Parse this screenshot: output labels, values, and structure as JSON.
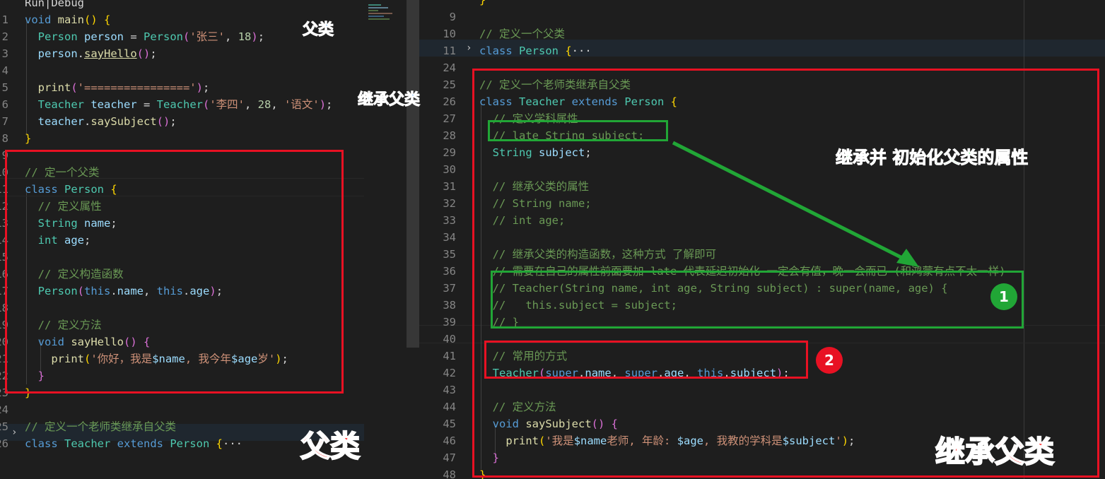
{
  "annotations": {
    "left_parent_small": "父类",
    "inherit_parent_small": "继承父类",
    "init_props": "继承并 初始化父类的属性",
    "left_parent_big": "父类",
    "right_inherit_big": "继承父类",
    "badge1": "1",
    "badge2": "2"
  },
  "colors": {
    "background": "#1e1e1e",
    "red_box": "#e81123",
    "green_box": "#21a636",
    "blue_annotation": "#1e90ff",
    "green_annotation": "#21c23a",
    "red_annotation": "#ff1a1a"
  },
  "left": {
    "lines": [
      {
        "ln": "",
        "tokens": [
          [
            "pl",
            "Run|Debug"
          ]
        ]
      },
      {
        "ln": "1",
        "tokens": [
          [
            "kw",
            "void "
          ],
          [
            "fn",
            "main"
          ],
          [
            "br",
            "() {"
          ]
        ]
      },
      {
        "ln": "2",
        "tokens": [
          [
            "ty",
            "  Person "
          ],
          [
            "va",
            "person"
          ],
          [
            "pl",
            " = "
          ],
          [
            "ty",
            "Person"
          ],
          [
            "br2",
            "("
          ],
          [
            "st",
            "'张三'"
          ],
          [
            "pl",
            ", "
          ],
          [
            "nu",
            "18"
          ],
          [
            "br2",
            ")"
          ],
          [
            "pl",
            ";"
          ]
        ]
      },
      {
        "ln": "3",
        "tokens": [
          [
            "va",
            "  person"
          ],
          [
            "pl",
            "."
          ],
          [
            "fnu",
            "sayHello"
          ],
          [
            "br2",
            "()"
          ],
          [
            "pl",
            ";"
          ]
        ]
      },
      {
        "ln": "4",
        "tokens": [
          [
            "pl",
            ""
          ]
        ]
      },
      {
        "ln": "5",
        "tokens": [
          [
            "fn",
            "  print"
          ],
          [
            "br2",
            "("
          ],
          [
            "st",
            "'================'"
          ],
          [
            "br2",
            ")"
          ],
          [
            "pl",
            ";"
          ]
        ]
      },
      {
        "ln": "6",
        "tokens": [
          [
            "ty",
            "  Teacher "
          ],
          [
            "va",
            "teacher"
          ],
          [
            "pl",
            " = "
          ],
          [
            "ty",
            "Teacher"
          ],
          [
            "br2",
            "("
          ],
          [
            "st",
            "'李四'"
          ],
          [
            "pl",
            ", "
          ],
          [
            "nu",
            "28"
          ],
          [
            "pl",
            ", "
          ],
          [
            "st",
            "'语文'"
          ],
          [
            "br2",
            ")"
          ],
          [
            "pl",
            ";"
          ]
        ]
      },
      {
        "ln": "7",
        "tokens": [
          [
            "va",
            "  teacher"
          ],
          [
            "pl",
            "."
          ],
          [
            "fn",
            "saySubject"
          ],
          [
            "br2",
            "()"
          ],
          [
            "pl",
            ";"
          ]
        ]
      },
      {
        "ln": "8",
        "tokens": [
          [
            "br",
            "}"
          ]
        ]
      },
      {
        "ln": "9",
        "tokens": [
          [
            "pl",
            ""
          ]
        ]
      },
      {
        "ln": "10",
        "tokens": [
          [
            "cm",
            "// 定一个父类"
          ]
        ]
      },
      {
        "ln": "11",
        "tokens": [
          [
            "kw",
            "class "
          ],
          [
            "ty",
            "Person "
          ],
          [
            "br",
            "{"
          ]
        ]
      },
      {
        "ln": "12",
        "tokens": [
          [
            "cm",
            "  // 定义属性"
          ]
        ]
      },
      {
        "ln": "13",
        "tokens": [
          [
            "ty",
            "  String "
          ],
          [
            "va",
            "name"
          ],
          [
            "pl",
            ";"
          ]
        ]
      },
      {
        "ln": "14",
        "tokens": [
          [
            "ty",
            "  int "
          ],
          [
            "va",
            "age"
          ],
          [
            "pl",
            ";"
          ]
        ]
      },
      {
        "ln": "15",
        "tokens": [
          [
            "pl",
            ""
          ]
        ]
      },
      {
        "ln": "16",
        "tokens": [
          [
            "cm",
            "  // 定义构造函数"
          ]
        ]
      },
      {
        "ln": "17",
        "tokens": [
          [
            "ty",
            "  Person"
          ],
          [
            "br2",
            "("
          ],
          [
            "kw",
            "this"
          ],
          [
            "pl",
            "."
          ],
          [
            "va",
            "name"
          ],
          [
            "pl",
            ", "
          ],
          [
            "kw",
            "this"
          ],
          [
            "pl",
            "."
          ],
          [
            "va",
            "age"
          ],
          [
            "br2",
            ")"
          ],
          [
            "pl",
            ";"
          ]
        ]
      },
      {
        "ln": "18",
        "tokens": [
          [
            "pl",
            ""
          ]
        ]
      },
      {
        "ln": "19",
        "tokens": [
          [
            "cm",
            "  // 定义方法"
          ]
        ]
      },
      {
        "ln": "20",
        "tokens": [
          [
            "kw",
            "  void "
          ],
          [
            "fn",
            "sayHello"
          ],
          [
            "br2",
            "() {"
          ]
        ]
      },
      {
        "ln": "21",
        "tokens": [
          [
            "fn",
            "    print"
          ],
          [
            "br",
            "("
          ],
          [
            "st",
            "'你好，我是"
          ],
          [
            "va",
            "$name"
          ],
          [
            "st",
            ", 我今年"
          ],
          [
            "va",
            "$age"
          ],
          [
            "st",
            "岁'"
          ],
          [
            "br",
            ")"
          ],
          [
            "pl",
            ";"
          ]
        ]
      },
      {
        "ln": "22",
        "tokens": [
          [
            "br2",
            "  }"
          ]
        ]
      },
      {
        "ln": "23",
        "tokens": [
          [
            "br",
            "}"
          ]
        ]
      },
      {
        "ln": "24",
        "tokens": [
          [
            "pl",
            ""
          ]
        ]
      },
      {
        "ln": "25",
        "tokens": [
          [
            "cm",
            "// 定义一个老师类继承自父类"
          ]
        ]
      },
      {
        "ln": "26",
        "tokens": [
          [
            "kw",
            "class "
          ],
          [
            "ty",
            "Teacher "
          ],
          [
            "kw",
            "extends "
          ],
          [
            "ty",
            "Person "
          ],
          [
            "br",
            "{"
          ],
          [
            "pl",
            "···"
          ]
        ]
      }
    ]
  },
  "right": {
    "lines": [
      {
        "ln": "",
        "tokens": [
          [
            "br",
            "}"
          ]
        ]
      },
      {
        "ln": "9",
        "tokens": [
          [
            "pl",
            ""
          ]
        ]
      },
      {
        "ln": "10",
        "tokens": [
          [
            "cm",
            "// 定义一个父类"
          ]
        ]
      },
      {
        "ln": "11",
        "tokens": [
          [
            "kw",
            "class "
          ],
          [
            "ty",
            "Person "
          ],
          [
            "br",
            "{"
          ],
          [
            "pl",
            "···"
          ]
        ]
      },
      {
        "ln": "24",
        "tokens": [
          [
            "pl",
            ""
          ]
        ]
      },
      {
        "ln": "25",
        "tokens": [
          [
            "cm",
            "// 定义一个老师类继承自父类"
          ]
        ]
      },
      {
        "ln": "26",
        "tokens": [
          [
            "kw",
            "class "
          ],
          [
            "ty",
            "Teacher "
          ],
          [
            "kw",
            "extends "
          ],
          [
            "ty",
            "Person "
          ],
          [
            "br",
            "{"
          ]
        ]
      },
      {
        "ln": "27",
        "tokens": [
          [
            "cm",
            "  // 定义学科属性"
          ]
        ]
      },
      {
        "ln": "28",
        "tokens": [
          [
            "cm",
            "  // late String subject;"
          ]
        ]
      },
      {
        "ln": "29",
        "tokens": [
          [
            "ty",
            "  String "
          ],
          [
            "va",
            "subject"
          ],
          [
            "pl",
            ";"
          ]
        ]
      },
      {
        "ln": "30",
        "tokens": [
          [
            "pl",
            ""
          ]
        ]
      },
      {
        "ln": "31",
        "tokens": [
          [
            "cm",
            "  // 继承父类的属性"
          ]
        ]
      },
      {
        "ln": "32",
        "tokens": [
          [
            "cm",
            "  // String name;"
          ]
        ]
      },
      {
        "ln": "33",
        "tokens": [
          [
            "cm",
            "  // int age;"
          ]
        ]
      },
      {
        "ln": "34",
        "tokens": [
          [
            "pl",
            ""
          ]
        ]
      },
      {
        "ln": "35",
        "tokens": [
          [
            "cm",
            "  // 继承父类的构造函数，这种方式 了解即可"
          ]
        ]
      },
      {
        "ln": "36",
        "tokens": [
          [
            "cm",
            "  // 需要在自己的属性前面要加 late 代表延迟初始化 一定会有值，晚一会而已 (和鸿蒙有点不太一样)"
          ]
        ]
      },
      {
        "ln": "37",
        "tokens": [
          [
            "cm",
            "  // Teacher(String name, int age, String subject) : super(name, age) {"
          ]
        ]
      },
      {
        "ln": "38",
        "tokens": [
          [
            "cm",
            "  //   this.subject = subject;"
          ]
        ]
      },
      {
        "ln": "39",
        "tokens": [
          [
            "cm",
            "  // }"
          ]
        ]
      },
      {
        "ln": "40",
        "tokens": [
          [
            "pl",
            ""
          ]
        ]
      },
      {
        "ln": "41",
        "tokens": [
          [
            "cm",
            "  // 常用的方式"
          ]
        ]
      },
      {
        "ln": "42",
        "tokens": [
          [
            "ty",
            "  Teacher"
          ],
          [
            "br2",
            "("
          ],
          [
            "kw",
            "super"
          ],
          [
            "pl",
            "."
          ],
          [
            "va",
            "name"
          ],
          [
            "pl",
            ", "
          ],
          [
            "kw",
            "super"
          ],
          [
            "pl",
            "."
          ],
          [
            "va",
            "age"
          ],
          [
            "pl",
            ", "
          ],
          [
            "kw",
            "this"
          ],
          [
            "pl",
            "."
          ],
          [
            "va",
            "subject"
          ],
          [
            "br2",
            ")"
          ],
          [
            "pl",
            ";"
          ]
        ]
      },
      {
        "ln": "43",
        "tokens": [
          [
            "pl",
            ""
          ]
        ]
      },
      {
        "ln": "44",
        "tokens": [
          [
            "cm",
            "  // 定义方法"
          ]
        ]
      },
      {
        "ln": "45",
        "tokens": [
          [
            "kw",
            "  void "
          ],
          [
            "fn",
            "saySubject"
          ],
          [
            "br2",
            "() {"
          ]
        ]
      },
      {
        "ln": "46",
        "tokens": [
          [
            "fn",
            "    print"
          ],
          [
            "br",
            "("
          ],
          [
            "st",
            "'我是"
          ],
          [
            "va",
            "$name"
          ],
          [
            "st",
            "老师, 年龄: "
          ],
          [
            "va",
            "$age"
          ],
          [
            "st",
            ", 我教的学科是"
          ],
          [
            "va",
            "$subject"
          ],
          [
            "st",
            "'"
          ],
          [
            "br",
            ")"
          ],
          [
            "pl",
            ";"
          ]
        ]
      },
      {
        "ln": "47",
        "tokens": [
          [
            "br2",
            "  }"
          ]
        ]
      },
      {
        "ln": "48",
        "tokens": [
          [
            "br",
            "}"
          ]
        ]
      }
    ]
  }
}
